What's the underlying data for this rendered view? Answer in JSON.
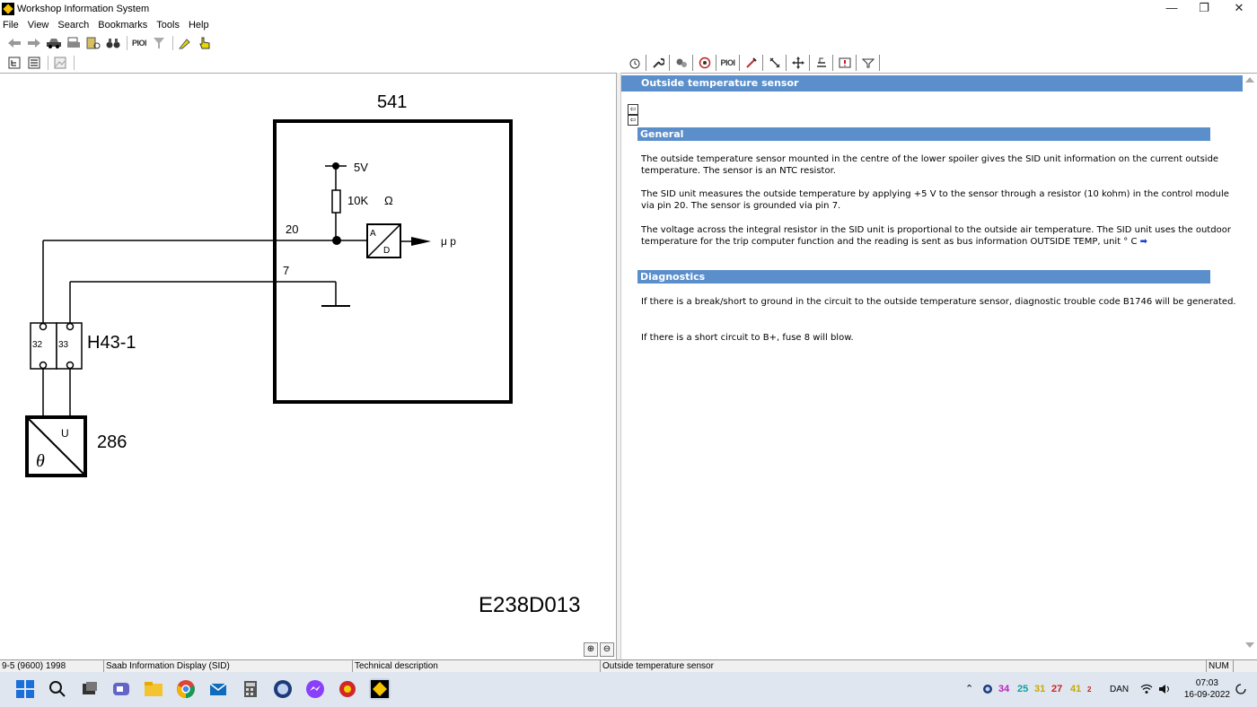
{
  "window": {
    "title": "Workshop Information System",
    "controls": [
      "—",
      "❐",
      "✕"
    ]
  },
  "menu": [
    "File",
    "View",
    "Search",
    "Bookmarks",
    "Tools",
    "Help"
  ],
  "toolbar": {
    "pi_label": "PIOI"
  },
  "tabs": {
    "pi_label": "PIOI"
  },
  "diagram": {
    "module_label": "541",
    "supply_label": "5V",
    "resistor_label": "10K",
    "ohm_label": "Ω",
    "pin_20": "20",
    "pin_7": "7",
    "ad_a": "A",
    "ad_d": "D",
    "mu_label": "μ p",
    "connector_label": "H43-1",
    "conn_pin_32": "32",
    "conn_pin_33": "33",
    "sensor_label": "286",
    "sensor_u": "U",
    "sensor_theta": "θ",
    "figure_id": "E238D013"
  },
  "document": {
    "title": "Outside temperature sensor",
    "sections": [
      {
        "heading": "General",
        "paragraphs": [
          "The outside temperature sensor mounted in the centre of the lower spoiler gives the SID unit information on the current outside temperature. The sensor is an NTC resistor.",
          "The SID unit measures the outside temperature by applying +5 V to the sensor through a resistor (10 kohm) in the control module via pin 20. The sensor is grounded via pin 7.",
          "The voltage across the integral resistor in the SID unit is proportional to the outside air temperature. The SID unit uses the outdoor temperature for the trip computer function and the reading is sent as bus information OUTSIDE TEMP, unit ° C"
        ]
      },
      {
        "heading": "Diagnostics",
        "paragraphs": [
          "If there is a break/short to ground in the circuit to the outside temperature sensor, diagnostic trouble code B1746 will be generated.",
          "If there is a short circuit to B+, fuse 8 will blow."
        ]
      }
    ]
  },
  "status": {
    "vehicle": "9-5 (9600) 1998",
    "system": "Saab Information Display (SID)",
    "doc_type": "Technical description",
    "doc_title": "Outside temperature sensor",
    "num": "NUM"
  },
  "taskbar": {
    "tray_numbers": [
      {
        "value": "34",
        "color": "#c020c0"
      },
      {
        "value": "25",
        "color": "#10a0a0"
      },
      {
        "value": "31",
        "color": "#c8a800"
      },
      {
        "value": "27",
        "color": "#d02020"
      },
      {
        "value": "41",
        "color": "#c8a800"
      }
    ],
    "lang": "DAN",
    "time": "07:03",
    "date": "16-09-2022",
    "badge": "2"
  },
  "colors": {
    "accent": "#5b8fcb",
    "link": "#1a3fd1"
  }
}
